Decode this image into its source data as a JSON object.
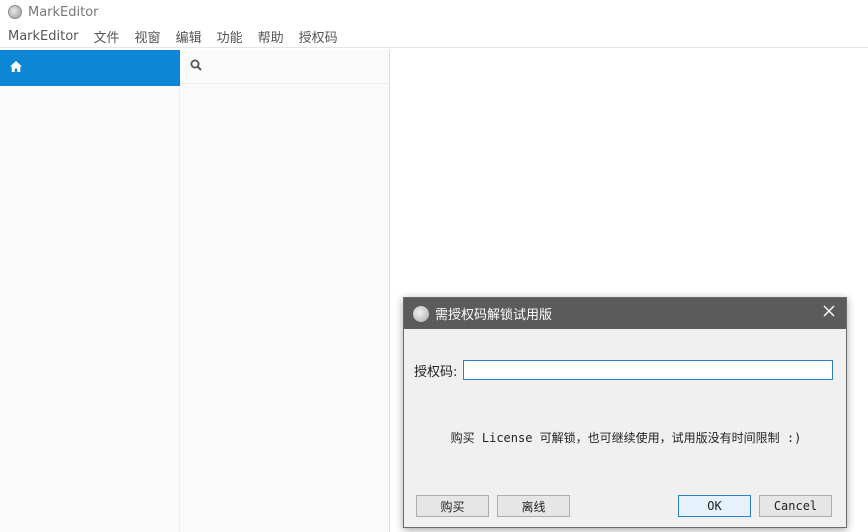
{
  "window": {
    "title": "MarkEditor"
  },
  "menu": [
    "MarkEditor",
    "文件",
    "视窗",
    "编辑",
    "功能",
    "帮助",
    "授权码"
  ],
  "dialog": {
    "title": "需授权码解锁试用版",
    "field_label": "授权码:",
    "license_value": "",
    "info": "购买 License 可解锁，也可继续使用，试用版没有时间限制 :)",
    "buttons": {
      "buy": "购买",
      "offline": "离线",
      "ok": "OK",
      "cancel": "Cancel"
    }
  },
  "colors": {
    "accent": "#0c87d6",
    "dialog_header": "#5b5b5b",
    "input_border": "#2a7fc6"
  },
  "icons": {
    "home": "home-icon",
    "search": "search-icon",
    "close": "close-icon"
  }
}
